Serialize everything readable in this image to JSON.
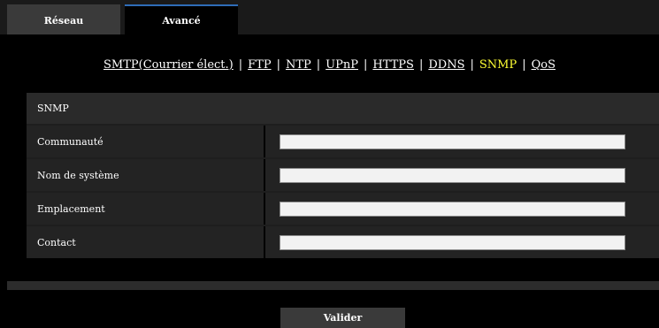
{
  "tabs": {
    "reseau": "Réseau",
    "avance": "Avancé"
  },
  "nav": {
    "smtp": "SMTP(Courrier élect.)",
    "ftp": "FTP",
    "ntp": "NTP",
    "upnp": "UPnP",
    "https": "HTTPS",
    "ddns": "DDNS",
    "snmp": "SNMP",
    "qos": "QoS",
    "separator": "|"
  },
  "snmp": {
    "section_title": "SNMP",
    "fields": {
      "community": {
        "label": "Communauté",
        "value": ""
      },
      "system_name": {
        "label": "Nom de système",
        "value": ""
      },
      "location": {
        "label": "Emplacement",
        "value": ""
      },
      "contact": {
        "label": "Contact",
        "value": ""
      }
    }
  },
  "actions": {
    "submit": "Valider"
  },
  "colors": {
    "active_link": "#ffff33",
    "active_tab_border": "#2f6db8"
  }
}
